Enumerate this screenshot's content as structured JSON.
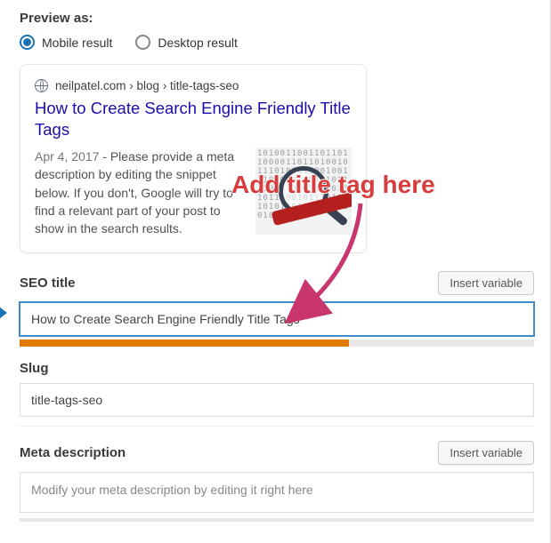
{
  "preview": {
    "label": "Preview as:",
    "options": {
      "mobile": "Mobile result",
      "desktop": "Desktop result"
    },
    "selected": "mobile"
  },
  "serp": {
    "breadcrumb": "neilpatel.com › blog › title-tags-seo",
    "title": "How to Create Search Engine Friendly Title Tags",
    "date": "Apr 4, 2017",
    "separator": " - ",
    "description": "Please provide a meta description by editing the snippet below. If you don't, Google will try to find a relevant part of your post to show in the search results."
  },
  "fields": {
    "seo_title": {
      "label": "SEO title",
      "value": "How to Create Search Engine Friendly Title Tags",
      "insert_variable_label": "Insert variable"
    },
    "slug": {
      "label": "Slug",
      "value": "title-tags-seo"
    },
    "meta_description": {
      "label": "Meta description",
      "placeholder": "Modify your meta description by editing it right here",
      "insert_variable_label": "Insert variable"
    }
  },
  "annotation": {
    "text": "Add title tag here"
  },
  "thumb_noise": "10100110011011011000011011010010111010101100100111010101001010111101010011011010101110010111010010101101001110110101"
}
